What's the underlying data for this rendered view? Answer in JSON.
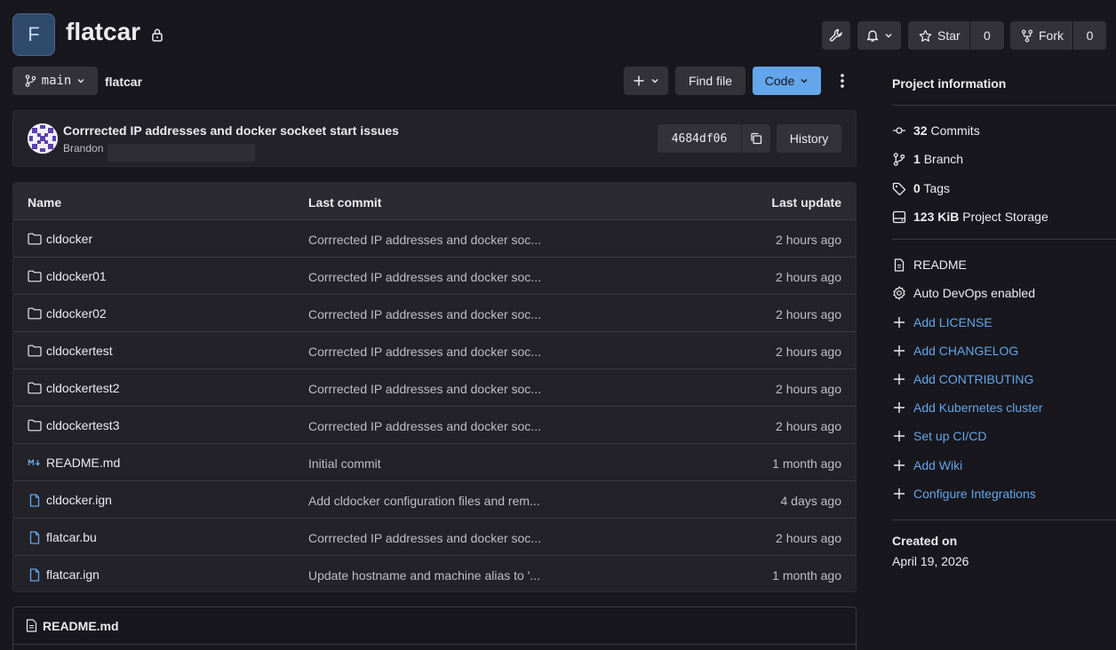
{
  "project": {
    "avatar_letter": "F",
    "name": "flatcar"
  },
  "header_actions": {
    "star_label": "Star",
    "star_count": "0",
    "fork_label": "Fork",
    "fork_count": "0"
  },
  "toolbar": {
    "branch": "main",
    "breadcrumb": "flatcar",
    "find_file": "Find file",
    "code": "Code"
  },
  "commit": {
    "message": "Corrrected IP addresses and docker sockeet start issues",
    "author": "Brandon",
    "sha": "4684df06",
    "history_label": "History"
  },
  "table": {
    "headers": {
      "name": "Name",
      "last_commit": "Last commit",
      "last_update": "Last update"
    },
    "rows": [
      {
        "icon": "folder-icon",
        "name": "cldocker",
        "commit": "Corrrected IP addresses and docker soc...",
        "date": "2 hours ago"
      },
      {
        "icon": "folder-icon",
        "name": "cldocker01",
        "commit": "Corrrected IP addresses and docker soc...",
        "date": "2 hours ago"
      },
      {
        "icon": "folder-icon",
        "name": "cldocker02",
        "commit": "Corrrected IP addresses and docker soc...",
        "date": "2 hours ago"
      },
      {
        "icon": "folder-icon",
        "name": "cldockertest",
        "commit": "Corrrected IP addresses and docker soc...",
        "date": "2 hours ago"
      },
      {
        "icon": "folder-icon",
        "name": "cldockertest2",
        "commit": "Corrrected IP addresses and docker soc...",
        "date": "2 hours ago"
      },
      {
        "icon": "folder-icon",
        "name": "cldockertest3",
        "commit": "Corrrected IP addresses and docker soc...",
        "date": "2 hours ago"
      },
      {
        "icon": "markdown-icon",
        "name": "README.md",
        "commit": "Initial commit",
        "date": "1 month ago"
      },
      {
        "icon": "file-icon",
        "name": "cldocker.ign",
        "commit": "Add cldocker configuration files and rem...",
        "date": "4 days ago"
      },
      {
        "icon": "file-icon",
        "name": "flatcar.bu",
        "commit": "Corrrected IP addresses and docker soc...",
        "date": "2 hours ago"
      },
      {
        "icon": "file-icon",
        "name": "flatcar.ign",
        "commit": "Update hostname and machine alias to '...",
        "date": "1 month ago"
      }
    ]
  },
  "readme": {
    "title": "README.md"
  },
  "sidebar": {
    "title": "Project information",
    "stats": [
      {
        "icon": "commit-icon",
        "count": "32",
        "label": "Commits"
      },
      {
        "icon": "branch-icon",
        "count": "1",
        "label": "Branch"
      },
      {
        "icon": "tag-icon",
        "count": "0",
        "label": "Tags"
      },
      {
        "icon": "storage-icon",
        "count": "123 KiB",
        "label": "Project Storage"
      }
    ],
    "items": [
      {
        "icon": "readme-icon",
        "label": "README",
        "link": false
      },
      {
        "icon": "settings-icon",
        "label": "Auto DevOps enabled",
        "link": false
      },
      {
        "icon": "plus-icon",
        "label": "Add LICENSE",
        "link": true
      },
      {
        "icon": "plus-icon",
        "label": "Add CHANGELOG",
        "link": true
      },
      {
        "icon": "plus-icon",
        "label": "Add CONTRIBUTING",
        "link": true
      },
      {
        "icon": "plus-icon",
        "label": "Add Kubernetes cluster",
        "link": true
      },
      {
        "icon": "plus-icon",
        "label": "Set up CI/CD",
        "link": true
      },
      {
        "icon": "plus-icon",
        "label": "Add Wiki",
        "link": true
      },
      {
        "icon": "plus-icon",
        "label": "Configure Integrations",
        "link": true
      }
    ],
    "created_label": "Created on",
    "created_date": "April 19, 2026"
  },
  "colors": {
    "background": "#18171d",
    "panel": "#232228",
    "button": "#333238",
    "accent": "#63a6e9",
    "text": "#ececef",
    "muted": "#bfbfc3"
  }
}
